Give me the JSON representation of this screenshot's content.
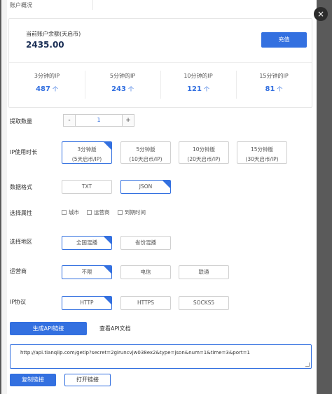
{
  "header": {
    "title": "账户概况",
    "close_icon": "×"
  },
  "account": {
    "balance_label": "当前账户余额(天启币)",
    "balance_value": "2435.00",
    "recharge_label": "充值",
    "stats": [
      {
        "label": "3分钟的IP",
        "value": "487",
        "unit": "个"
      },
      {
        "label": "5分钟的IP",
        "value": "243",
        "unit": "个"
      },
      {
        "label": "10分钟的IP",
        "value": "121",
        "unit": "个"
      },
      {
        "label": "15分钟的IP",
        "value": "81",
        "unit": "个"
      }
    ]
  },
  "form": {
    "quantity": {
      "label": "提取数量",
      "minus": "-",
      "value": "1",
      "plus": "+"
    },
    "duration": {
      "label": "IP使用时长",
      "options": [
        {
          "line1": "3分钟版",
          "line2": "(5天启币/IP)",
          "selected": true
        },
        {
          "line1": "5分钟版",
          "line2": "(10天启币/IP)",
          "selected": false
        },
        {
          "line1": "10分钟版",
          "line2": "(20天启币/IP)",
          "selected": false
        },
        {
          "line1": "15分钟版",
          "line2": "(30天启币/IP)",
          "selected": false
        }
      ]
    },
    "format": {
      "label": "数据格式",
      "options": [
        {
          "label": "TXT",
          "selected": false
        },
        {
          "label": "JSON",
          "selected": true
        }
      ]
    },
    "attributes": {
      "label": "选择属性",
      "options": [
        "城市",
        "运营商",
        "到期时间"
      ]
    },
    "region": {
      "label": "选择地区",
      "options": [
        {
          "label": "全国混播",
          "selected": true
        },
        {
          "label": "省份混播",
          "selected": false
        }
      ]
    },
    "carrier": {
      "label": "运营商",
      "options": [
        {
          "label": "不限",
          "selected": true
        },
        {
          "label": "电信",
          "selected": false
        },
        {
          "label": "联通",
          "selected": false
        }
      ]
    },
    "protocol": {
      "label": "IP协议",
      "options": [
        {
          "label": "HTTP",
          "selected": true
        },
        {
          "label": "HTTPS",
          "selected": false
        },
        {
          "label": "SOCKS5",
          "selected": false
        }
      ]
    }
  },
  "actions": {
    "generate_label": "生成API链接",
    "doc_label": "查看API文档",
    "api_url": "http://api.tianqiip.com/getip?secret=2giruncvjw038ex2&type=json&num=1&time=3&port=1",
    "copy_label": "复制链接",
    "open_label": "打开链接"
  },
  "colors": {
    "accent": "#3370e0",
    "overlay": "#5a5a5a"
  }
}
